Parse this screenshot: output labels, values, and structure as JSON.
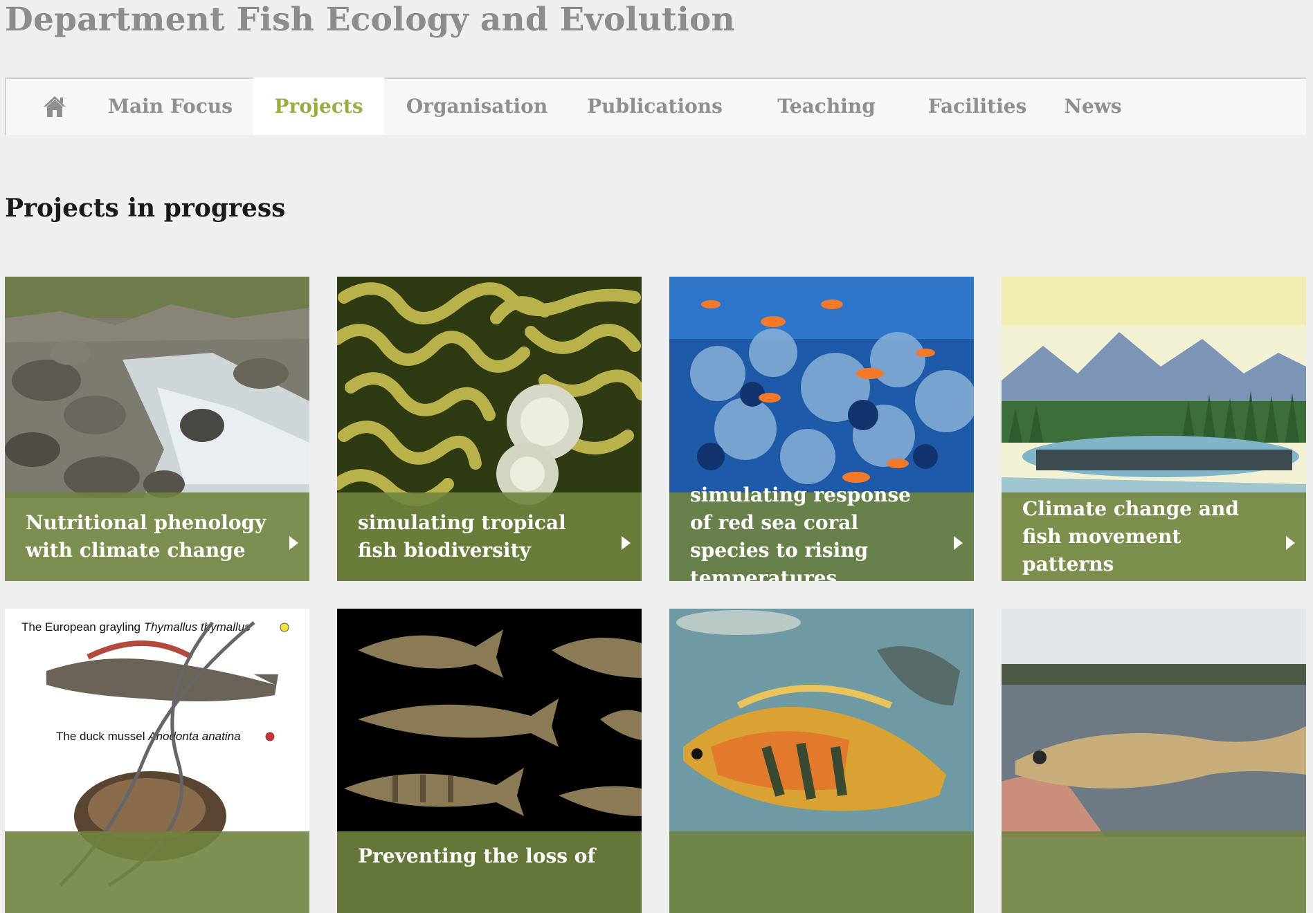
{
  "site": {
    "title": "Department Fish Ecology and Evolution"
  },
  "nav": {
    "home_icon": "home-icon",
    "items": [
      {
        "label": "Main Focus"
      },
      {
        "label": "Projects",
        "active": true
      },
      {
        "label": "Organisation"
      },
      {
        "label": "Publications"
      },
      {
        "label": "Teaching"
      },
      {
        "label": "Facilities"
      },
      {
        "label": "News"
      }
    ]
  },
  "colors": {
    "accent": "#98ad45",
    "caption_bg": "#70843e",
    "page_bg": "#efefef",
    "nav_text": "#8f8f8f"
  },
  "section": {
    "heading": "Projects in progress"
  },
  "projects": [
    {
      "title": "Nutritional phenology with climate change",
      "image": "mountain stream with rocks"
    },
    {
      "title": "simulating tropical fish biodiversity",
      "image": "brain coral with feather duster worm"
    },
    {
      "title": "simulating response of red sea coral species to rising temperatures",
      "image": "coral reef with orange fish"
    },
    {
      "title": "Climate change and fish movement patterns",
      "image": "watercolor lake with mountains and fish pass"
    },
    {
      "title": "",
      "image": "grayling and duck mussel illustration with DNA helix",
      "image_text": {
        "line1_pre": "The European grayling ",
        "line1_italic": "Thymallus thymallus",
        "line2_pre": "The duck mussel ",
        "line2_italic": "Anodonta anatina"
      }
    },
    {
      "title": "Preventing the loss of",
      "image": "several fish species on black background"
    },
    {
      "title": "",
      "image": "colorful cichlid fish underwater"
    },
    {
      "title": "",
      "image": "hand holding a fish at a lake"
    }
  ]
}
